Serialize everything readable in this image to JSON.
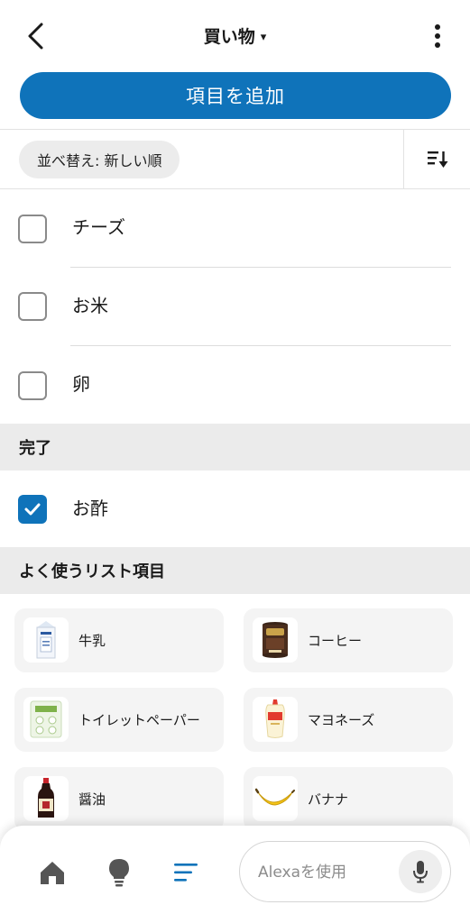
{
  "header": {
    "title": "買い物",
    "caret": "▾"
  },
  "add_button": {
    "label": "項目を追加"
  },
  "sort": {
    "label": "並べ替え: 新しい順"
  },
  "list_items": [
    {
      "label": "チーズ",
      "checked": false
    },
    {
      "label": "お米",
      "checked": false
    },
    {
      "label": "卵",
      "checked": false
    }
  ],
  "completed": {
    "title": "完了",
    "items": [
      {
        "label": "お酢",
        "checked": true
      }
    ]
  },
  "favorites": {
    "title": "よく使うリスト項目",
    "items": [
      {
        "label": "牛乳",
        "icon": "milk-carton-icon"
      },
      {
        "label": "コーヒー",
        "icon": "coffee-can-icon"
      },
      {
        "label": "トイレットペーパー",
        "icon": "toilet-paper-icon"
      },
      {
        "label": "マヨネーズ",
        "icon": "mayonnaise-icon"
      },
      {
        "label": "醤油",
        "icon": "soy-sauce-icon"
      },
      {
        "label": "バナナ",
        "icon": "banana-icon"
      }
    ]
  },
  "bottom_nav": {
    "items": [
      "home-icon",
      "lightbulb-icon",
      "lists-icon"
    ],
    "active": "lists-icon",
    "alexa_placeholder": "Alexaを使用"
  },
  "colors": {
    "accent": "#0f73ba",
    "section_bg": "#ebebeb",
    "card_bg": "#f4f4f4",
    "icon_gray": "#555555"
  }
}
